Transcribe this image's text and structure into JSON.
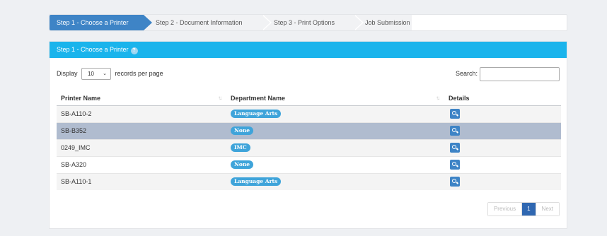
{
  "wizard": {
    "steps": [
      {
        "label": "Step 1 - Choose a Printer",
        "active": true
      },
      {
        "label": "Step 2 - Document Information",
        "active": false
      },
      {
        "label": "Step 3 - Print Options",
        "active": false
      },
      {
        "label": "Job Submission",
        "active": false
      }
    ]
  },
  "panel": {
    "title": "Step 1 - Choose a Printer",
    "help_icon": "help-icon"
  },
  "length_control": {
    "prefix": "Display",
    "value": "10",
    "suffix": "records per page"
  },
  "search": {
    "label": "Search:",
    "value": ""
  },
  "table": {
    "headers": [
      "Printer Name",
      "Department Name",
      "Details"
    ],
    "rows": [
      {
        "printer": "SB-A110-2",
        "department": "Language Arts",
        "selected": false
      },
      {
        "printer": "SB-B352",
        "department": "None",
        "selected": true
      },
      {
        "printer": "0249_IMC",
        "department": "IMC",
        "selected": false
      },
      {
        "printer": "SB-A320",
        "department": "None",
        "selected": false
      },
      {
        "printer": "SB-A110-1",
        "department": "Language Arts",
        "selected": false
      }
    ]
  },
  "pagination": {
    "previous": "Previous",
    "current": "1",
    "next": "Next"
  },
  "colors": {
    "accent": "#3e84c6",
    "panel_header": "#1ab4ec",
    "badge": "#3fa4da",
    "selected_row": "#b0bccf"
  }
}
